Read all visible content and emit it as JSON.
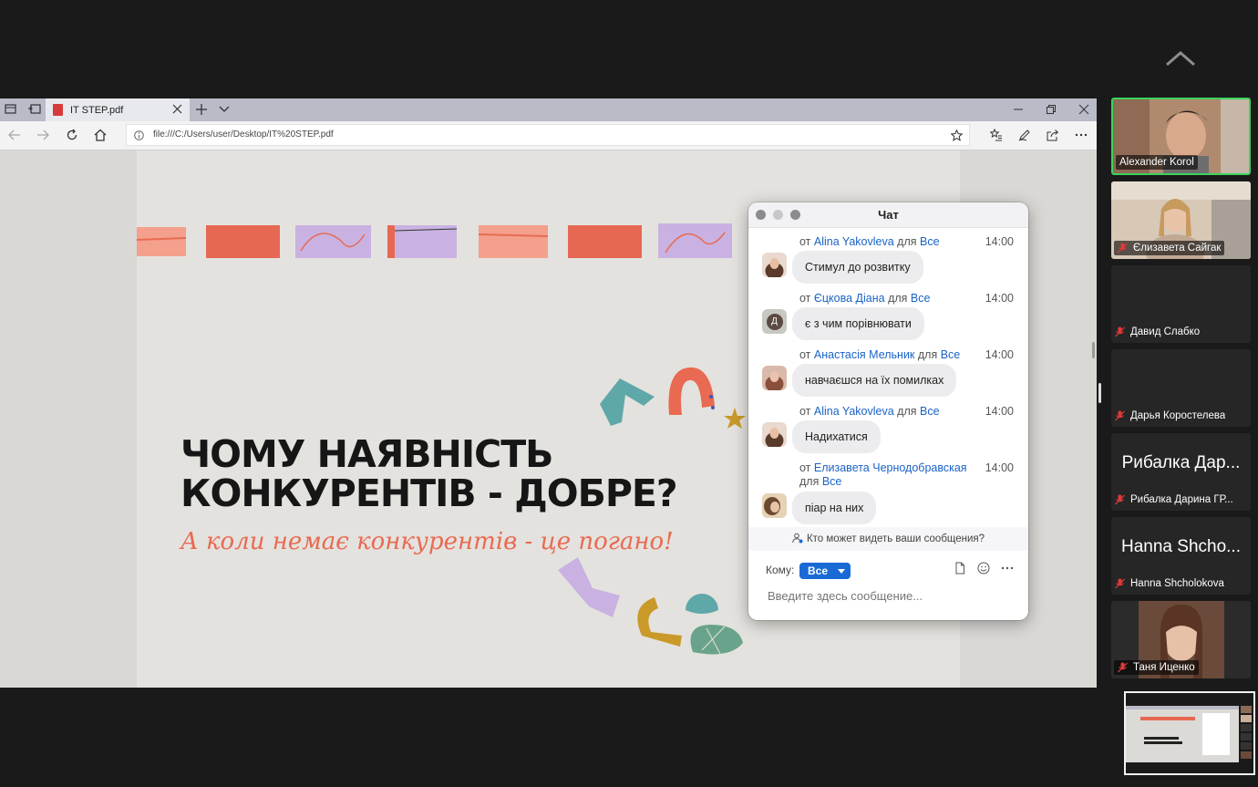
{
  "browser": {
    "tab_title": "IT STEP.pdf",
    "url": "file:///C:/Users/user/Desktop/IT%20STEP.pdf"
  },
  "slide": {
    "title": "ЧОМУ НАЯВНІСТЬ\nКОНКУРЕНТІВ - ДОБРЕ?",
    "subtitle": "А коли немає конкурентів - це погано!"
  },
  "chat": {
    "title": "Чат",
    "from_prefix": "от",
    "to_word": "для",
    "messages": [
      {
        "sender": "Alina Yakovleva",
        "recipient": "Все",
        "time": "14:00",
        "text": "Стимул до розвитку",
        "avatar": "photo-avatar"
      },
      {
        "sender": "Єцкова Діана",
        "recipient": "Все",
        "time": "14:00",
        "text": "є з чим порівнювати",
        "avatar": "letter-avatar",
        "avatar_letter": "Д"
      },
      {
        "sender": "Анастасія Мельник",
        "recipient": "Все",
        "time": "14:00",
        "text": "навчаєшся на їх помилках",
        "avatar": "photo-avatar"
      },
      {
        "sender": "Alina Yakovleva",
        "recipient": "Все",
        "time": "14:00",
        "text": "Надихатися",
        "avatar": "photo-avatar"
      },
      {
        "sender": "Елизавета Чернодобравская",
        "recipient": "Все",
        "time": "14:00",
        "text": "піар на них",
        "avatar": "photo-avatar"
      }
    ],
    "privacy_note": "Кто может видеть ваши сообщения?",
    "to_label": "Кому:",
    "to_value": "Все",
    "input_placeholder": "Введите здесь сообщение..."
  },
  "participants": [
    {
      "name": "Alexander Korol",
      "big_name": "",
      "video": true,
      "muted": false,
      "active": true
    },
    {
      "name": "Єлизавета Сайгак",
      "big_name": "",
      "video": true,
      "muted": true,
      "active": false
    },
    {
      "name": "Давид Слабко",
      "big_name": "",
      "video": false,
      "muted": true,
      "active": false
    },
    {
      "name": "Дарья Коростелева",
      "big_name": "",
      "video": false,
      "muted": true,
      "active": false
    },
    {
      "name": "Рибалка Дарина ГР...",
      "big_name": "Рибалка Дар...",
      "video": false,
      "muted": true,
      "active": false
    },
    {
      "name": "Hanna Shcholokova",
      "big_name": "Hanna Shcho...",
      "video": false,
      "muted": true,
      "active": false
    },
    {
      "name": "Таня Иценко",
      "big_name": "",
      "video": true,
      "muted": true,
      "active": false
    }
  ],
  "colors": {
    "accent_blue": "#1a6ad6",
    "active_speaker": "#3ad45c",
    "slide_orange": "#e96a52",
    "slide_lilac": "#c9b2e2"
  },
  "icons": [
    "chevron-up-icon",
    "pdf-icon",
    "close-icon",
    "plus-icon",
    "back-icon",
    "forward-icon",
    "refresh-icon",
    "home-icon",
    "info-icon",
    "star-icon",
    "mic-off-icon",
    "file-icon",
    "emoji-icon",
    "more-icon"
  ]
}
